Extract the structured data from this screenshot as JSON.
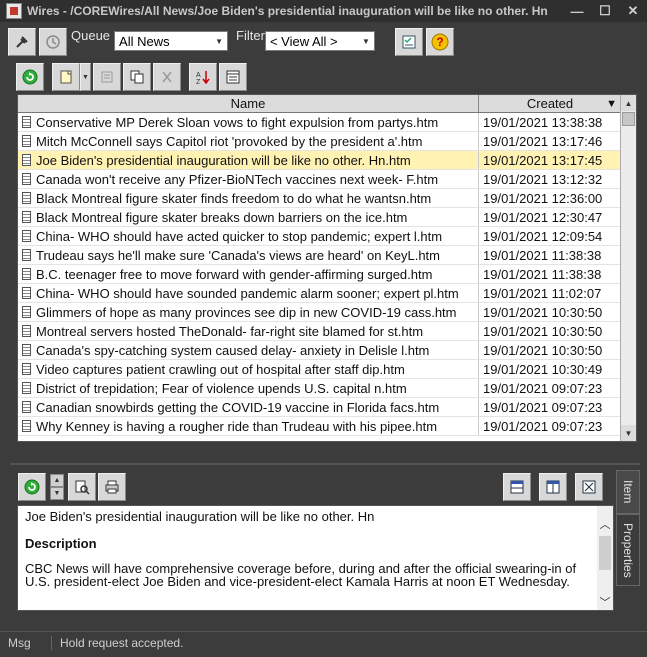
{
  "window": {
    "title": "Wires - /COREWires/All News/Joe Biden's presidential inauguration will be like no other. Hn",
    "minimize": "—",
    "maximize": "☐",
    "close": "✕"
  },
  "toolbar": {
    "queue_label": "Queue",
    "queue_value": "All News",
    "filter_label": "Filter",
    "filter_value": "< View All >"
  },
  "grid": {
    "columns": {
      "name": "Name",
      "created": "Created"
    },
    "rows": [
      {
        "name": "Conservative MP Derek Sloan vows to fight expulsion from partys.htm",
        "created": "19/01/2021 13:38:38"
      },
      {
        "name": "Mitch McConnell says Capitol riot 'provoked by the president a'.htm",
        "created": "19/01/2021 13:17:46"
      },
      {
        "name": "Joe Biden's presidential inauguration will be like no other. Hn.htm",
        "created": "19/01/2021 13:17:45",
        "selected": true
      },
      {
        "name": "Canada won't receive any Pfizer-BioNTech vaccines next week- F.htm",
        "created": "19/01/2021 13:12:32"
      },
      {
        "name": "Black Montreal figure skater finds freedom to do what he wantsn.htm",
        "created": "19/01/2021 12:36:00"
      },
      {
        "name": "Black Montreal figure skater breaks down barriers on the ice.htm",
        "created": "19/01/2021 12:30:47"
      },
      {
        "name": "China- WHO should have acted quicker to stop pandemic; expert l.htm",
        "created": "19/01/2021 12:09:54"
      },
      {
        "name": "Trudeau says he'll make sure 'Canada's views are heard' on KeyL.htm",
        "created": "19/01/2021 11:38:38"
      },
      {
        "name": "B.C. teenager free to move forward with gender-affirming surged.htm",
        "created": "19/01/2021 11:38:38"
      },
      {
        "name": "China- WHO should have sounded pandemic alarm sooner; expert pl.htm",
        "created": "19/01/2021 11:02:07"
      },
      {
        "name": "Glimmers of hope as many provinces see dip in new COVID-19 cass.htm",
        "created": "19/01/2021 10:30:50"
      },
      {
        "name": "Montreal servers hosted TheDonald- far-right site blamed for st.htm",
        "created": "19/01/2021 10:30:50"
      },
      {
        "name": "Canada's spy-catching system caused delay- anxiety in Delisle l.htm",
        "created": "19/01/2021 10:30:50"
      },
      {
        "name": "Video captures patient crawling out of hospital after staff dip.htm",
        "created": "19/01/2021 10:30:49"
      },
      {
        "name": "District of trepidation; Fear of violence upends U.S. capital n.htm",
        "created": "19/01/2021 09:07:23"
      },
      {
        "name": "Canadian snowbirds getting the COVID-19 vaccine in Florida facs.htm",
        "created": "19/01/2021 09:07:23"
      },
      {
        "name": "Why Kenney is having a rougher ride than Trudeau with his pipee.htm",
        "created": "19/01/2021 09:07:23"
      }
    ]
  },
  "detail": {
    "title": "Joe Biden's presidential inauguration will be like no other. Hn",
    "description_label": "Description",
    "description": "CBC News will have comprehensive coverage before, during and after the official swearing-in of U.S. president-elect Joe Biden and vice-president-elect Kamala Harris at noon ET Wednesday."
  },
  "side_tabs": {
    "item": "Item",
    "properties": "Properties"
  },
  "status": {
    "msg_label": "Msg",
    "message": "Hold request accepted."
  }
}
